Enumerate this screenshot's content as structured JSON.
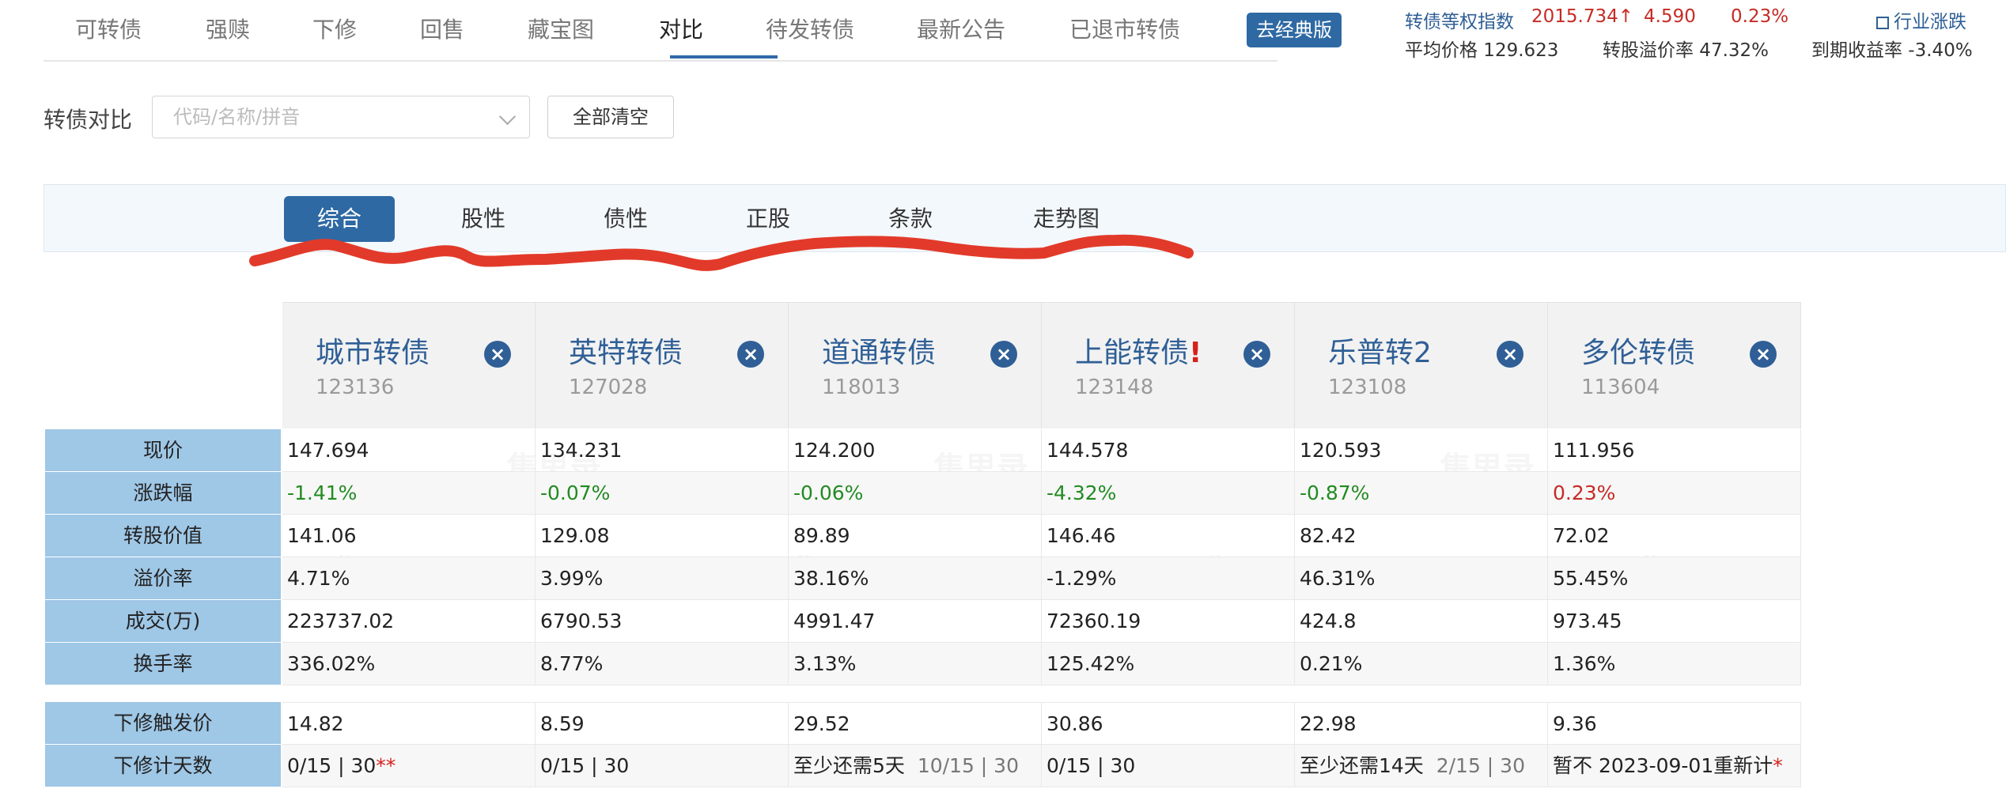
{
  "nav": {
    "items": [
      "可转债",
      "强赎",
      "下修",
      "回售",
      "藏宝图",
      "对比",
      "待发转债",
      "最新公告",
      "已退市转债"
    ],
    "active": "对比",
    "classic_label": "去经典版"
  },
  "index": {
    "name": "转债等权指数",
    "value": "2015.734↑",
    "change": "4.590",
    "pct": "0.23%",
    "industry_link": "行业涨跌",
    "avg_price": "平均价格 129.623",
    "premium": "转股溢价率 47.32%",
    "ytm": "到期收益率 -3.40%"
  },
  "compare": {
    "label": "转债对比",
    "search_placeholder": "代码/名称/拼音",
    "clear_label": "全部清空"
  },
  "tabs": [
    "综合",
    "股性",
    "债性",
    "正股",
    "条款",
    "走势图"
  ],
  "tabs_active": "综合",
  "bonds": [
    {
      "name": "城市转债",
      "flag": "",
      "code": "123136"
    },
    {
      "name": "英特转债",
      "flag": "",
      "code": "127028"
    },
    {
      "name": "道通转债",
      "flag": "",
      "code": "118013"
    },
    {
      "name": "上能转债",
      "flag": "!",
      "code": "123148"
    },
    {
      "name": "乐普转2",
      "flag": "",
      "code": "123108"
    },
    {
      "name": "多伦转债",
      "flag": "",
      "code": "113604"
    }
  ],
  "close_glyph": "×",
  "rows": [
    {
      "label": "现价",
      "values": [
        "147.694",
        "134.231",
        "124.200",
        "144.578",
        "120.593",
        "111.956"
      ]
    },
    {
      "label": "涨跌幅",
      "values": [
        "-1.41%",
        "-0.07%",
        "-0.06%",
        "-4.32%",
        "-0.87%",
        "0.23%"
      ]
    },
    {
      "label": "转股价值",
      "values": [
        "141.06",
        "129.08",
        "89.89",
        "146.46",
        "82.42",
        "72.02"
      ]
    },
    {
      "label": "溢价率",
      "values": [
        "4.71%",
        "3.99%",
        "38.16%",
        "-1.29%",
        "46.31%",
        "55.45%"
      ]
    },
    {
      "label": "成交(万)",
      "values": [
        "223737.02",
        "6790.53",
        "4991.47",
        "72360.19",
        "424.8",
        "973.45"
      ]
    },
    {
      "label": "换手率",
      "values": [
        "336.02%",
        "8.77%",
        "3.13%",
        "125.42%",
        "0.21%",
        "1.36%"
      ]
    }
  ],
  "rows2": [
    {
      "label": "下修触发价",
      "values": [
        "14.82",
        "8.59",
        "29.52",
        "30.86",
        "22.98",
        "9.36"
      ]
    }
  ],
  "days_row": {
    "label": "下修计天数",
    "cells": [
      {
        "prefix": "",
        "main": "0/15 | 30",
        "star": "**"
      },
      {
        "prefix": "",
        "main": "0/15 | 30",
        "star": ""
      },
      {
        "prefix": "至少还需5天",
        "main": "10/15 | 30",
        "star": ""
      },
      {
        "prefix": "",
        "main": "0/15 | 30",
        "star": ""
      },
      {
        "prefix": "至少还需14天",
        "main": "2/15 | 30",
        "star": ""
      },
      {
        "prefix": "",
        "main": "暂不 2023-09-01重新计",
        "star": "*"
      }
    ]
  },
  "colors": {
    "accent": "#2e69a3",
    "label_bg": "#9fc7e6",
    "down": "#228b22",
    "up": "#c62b25"
  }
}
